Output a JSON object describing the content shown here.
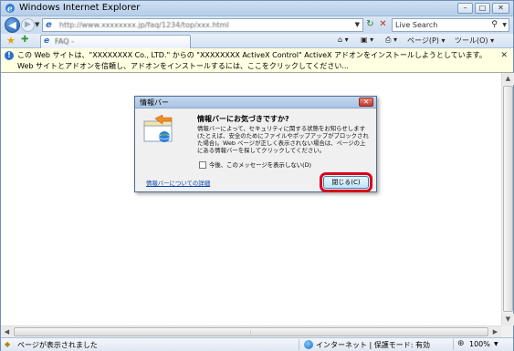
{
  "window": {
    "title": "Windows Internet Explorer",
    "buttons": {
      "minimize": "–",
      "maximize": "□",
      "close": "✕"
    }
  },
  "addressbar": {
    "url": "http://www.xxxxxxxx.jp/faq/1234/top/xxx.html",
    "search_placeholder": "Live Search"
  },
  "toolbar": {
    "tab_label": "FAQ - ",
    "page_menu": "ページ(P)",
    "tools_menu": "ツール(O)"
  },
  "infobar": {
    "text": "この Web サイトは、\"XXXXXXXX Co., LTD.\" からの \"XXXXXXXX ActiveX Control\" ActiveX アドオンをインストールしようとしています。Web サイトとアドオンを信頼し、アドオンをインストールするには、ここをクリックしてください..."
  },
  "dialog": {
    "title": "情報バー",
    "heading": "情報バーにお気づきですか?",
    "body": "情報バーによって、セキュリティに関する状態をお知らせします (たとえば、安全のためにファイルやポップアップがブロックされた場合)。Web ページが正しく表示されない場合は、ページの上にある情報バーを探してクリックしてください。",
    "checkbox_label": "今後、このメッセージを表示しない(D)",
    "link": "情報バーについての詳細",
    "close_button": "閉じる(C)"
  },
  "statusbar": {
    "status": "ページが表示されました",
    "zone": "インターネット | 保護モード: 有効",
    "zoom": "100%"
  }
}
